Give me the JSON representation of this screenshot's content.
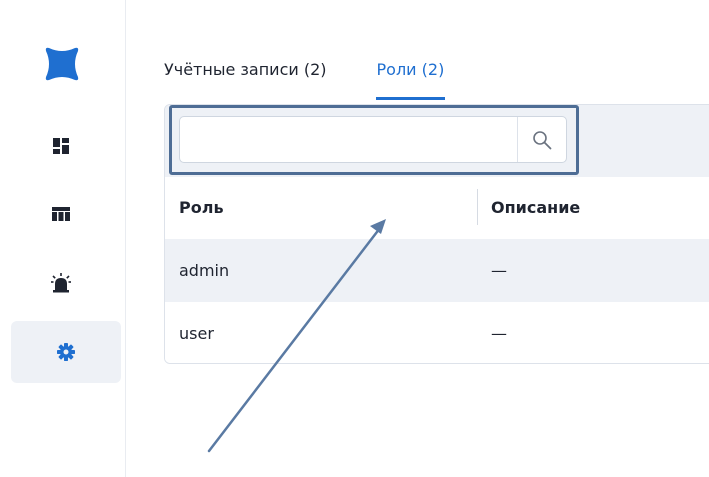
{
  "tabs": [
    {
      "label": "Учётные записи (2)"
    },
    {
      "label": "Роли (2)"
    }
  ],
  "search": {
    "value": "",
    "placeholder": ""
  },
  "table": {
    "columns": [
      "Роль",
      "Описание"
    ],
    "rows": [
      {
        "role": "admin",
        "description": "—"
      },
      {
        "role": "user",
        "description": "—"
      }
    ]
  },
  "icons": {
    "logo": "app-logo-icon",
    "dashboard": "dashboard-icon",
    "table": "table-icon",
    "alarm": "alarm-icon",
    "settings": "gear-icon",
    "search": "search-icon"
  },
  "colors": {
    "accent": "#1f6fd0",
    "logo": "#1f6fd0",
    "highlight": "#4e6d95",
    "sidebar_active_bg": "#eef1f6"
  }
}
